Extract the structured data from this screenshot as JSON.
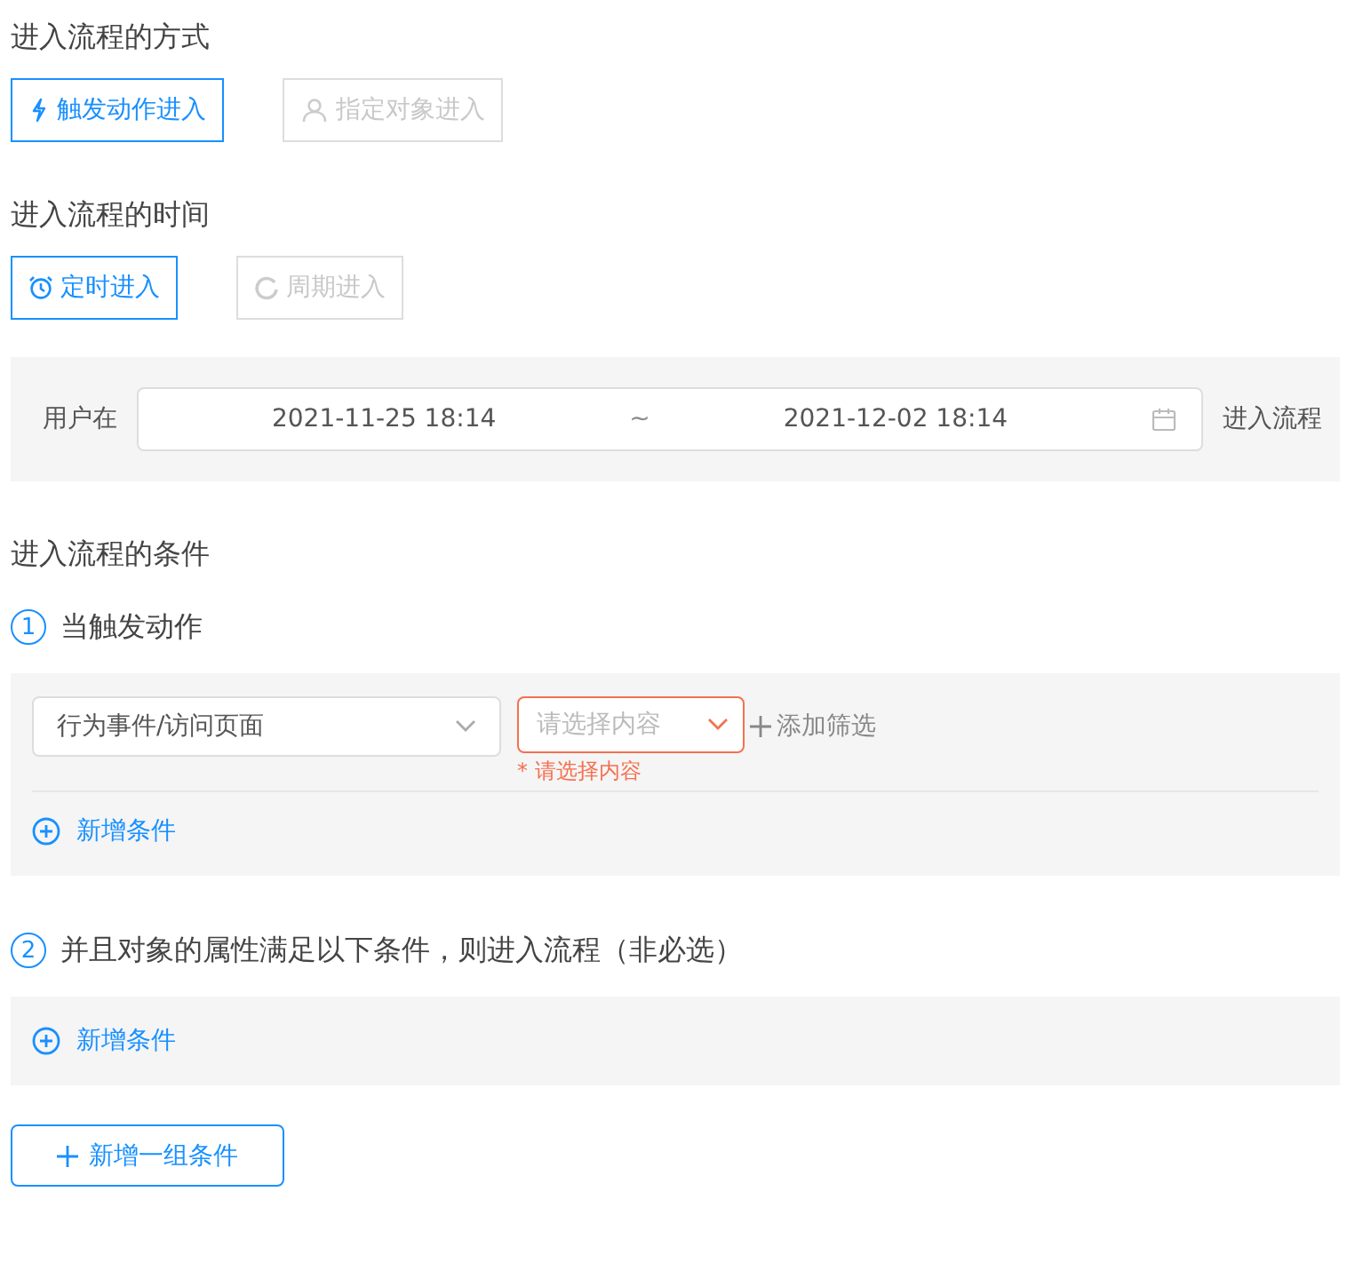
{
  "entry_mode": {
    "title": "进入流程的方式",
    "options": [
      {
        "label": "触发动作进入",
        "kind": "bolt",
        "selected": true
      },
      {
        "label": "指定对象进入",
        "kind": "user",
        "selected": false
      }
    ]
  },
  "entry_time": {
    "title": "进入流程的时间",
    "options": [
      {
        "label": "定时进入",
        "kind": "alarm",
        "selected": true
      },
      {
        "label": "周期进入",
        "kind": "cycle",
        "selected": false
      }
    ],
    "range": {
      "prefix": "用户在",
      "start": "2021-11-25 18:14",
      "separator": "~",
      "end": "2021-12-02 18:14",
      "suffix": "进入流程"
    }
  },
  "conditions": {
    "title": "进入流程的条件",
    "steps": [
      {
        "number": "1",
        "title": "当触发动作",
        "rows": [
          {
            "event": "行为事件/访问页面",
            "placeholder": "请选择内容",
            "error": "* 请选择内容",
            "add_filter": "添加筛选"
          }
        ],
        "add_label": "新增条件"
      },
      {
        "number": "2",
        "title": "并且对象的属性满足以下条件，则进入流程（非必选）",
        "add_label": "新增条件"
      }
    ],
    "add_group": "新增一组条件"
  }
}
